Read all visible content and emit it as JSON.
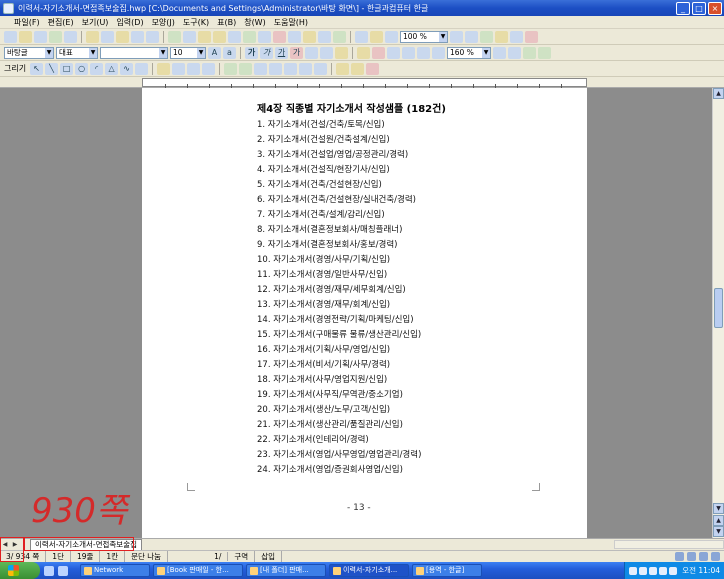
{
  "window": {
    "title": "이력서-자기소개서-면접족보술집.hwp [C:\\Documents and Settings\\Administrator\\바탕 화면\\] - 한글과컴퓨터 한글"
  },
  "menu": [
    "파일(F)",
    "편집(E)",
    "보기(U)",
    "입력(D)",
    "모양(J)",
    "도구(K)",
    "표(B)",
    "창(W)",
    "도움말(H)"
  ],
  "toolbar": {
    "style_combo": "바탕글",
    "font_lang_combo": "대표",
    "font_name_combo": "",
    "font_size_combo": "10",
    "zoom_combo": "160 %",
    "zoom_combo_main": "100 %"
  },
  "document": {
    "heading": "제4장 직종별 자기소개서 작성샘플 (182건)",
    "items": [
      "1.  자기소개서(건설/건축/토목/신입)",
      "2.  자기소개서(건설원/건축설계/신입)",
      "3.  자기소개서(건설업/영업/공정관리/경력)",
      "4.  자기소개서(건설직/현장기사/신입)",
      "5.  자기소개서(건축/건설현장/신입)",
      "6.  자기소개서(건축/건설현장/실내건축/경력)",
      "7.  자기소개서(건축/설계/감리/신입)",
      "8.  자기소개서(결혼정보회사/매칭플래너)",
      "9.  자기소개서(결혼정보회사/홍보/경력)",
      "10.  자기소개서(경영/사무/기획/신입)",
      "11.  자기소개서(경영/일반사무/신입)",
      "12.  자기소개서(경영/재무/세무회계/신입)",
      "13.  자기소개서(경영/재무/회계/신입)",
      "14.  자기소개서(경영전략/기획/마케팅/신입)",
      "15.  자기소개서(구매물류 물류/생산관리/신입)",
      "16.  자기소개서(기획/사무/영업/신입)",
      "17.  자기소개서(비서/기획/사무/경력)",
      "18.  자기소개서(사무/영업지원/신입)",
      "19.  자기소개서(사무직/무역관/중소기업)",
      "20.  자기소개서(생산/노무/고객/신입)",
      "21.  자기소개서(생산관리/품질관리/신입)",
      "22.  자기소개서(인테리어/경력)",
      "23.  자기소개서(영업/사무영업/영업관리/경력)",
      "24.  자기소개서(영업/증권회사영업/신입)"
    ],
    "page_number": "- 13 -"
  },
  "annotation": {
    "handwritten": "930쪽"
  },
  "doc_tab": {
    "label": "이력서-자기소개서-면접족보술집"
  },
  "status": {
    "page": "3/ 934 쪽",
    "section": "1단",
    "line": "19줄",
    "column": "1칸",
    "caption": "문단 나눔",
    "insert_mode": "1/",
    "mode2": "구역",
    "mode3": "삽입"
  },
  "taskbar": {
    "tasks": [
      "Network",
      "[Book 판매일 - 한...",
      "[내 폴더] 판매...",
      "이력서-자기소개...",
      "[용역 - 한글]"
    ],
    "clock": "오전 11:04"
  },
  "colors": {
    "titlebar": "#1c4fc4",
    "annotation_ink": "#d42a2a",
    "highlight_box": "#e02020"
  }
}
